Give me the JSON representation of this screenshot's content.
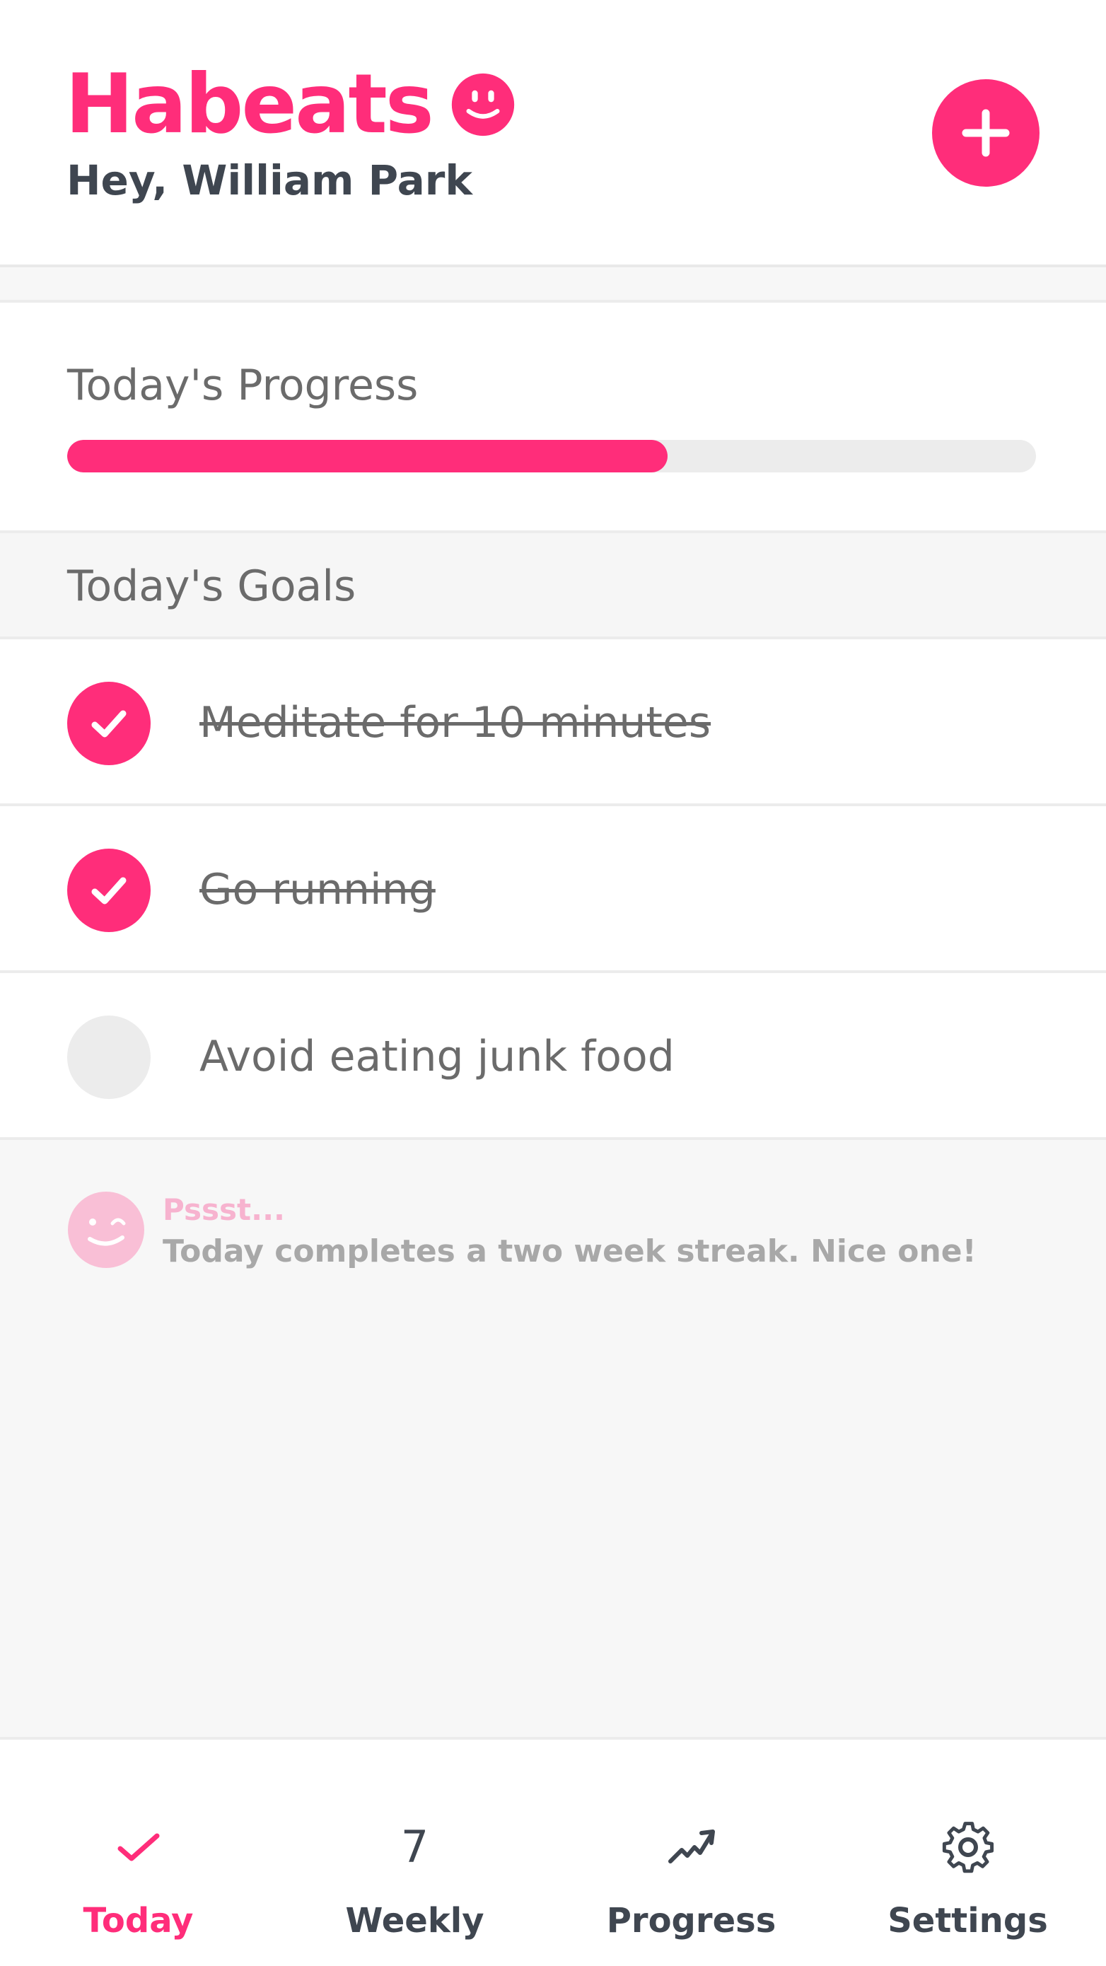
{
  "header": {
    "app_name": "Habeats",
    "greeting": "Hey, William Park",
    "add_button_icon": "plus-icon",
    "logo_icon": "smiley-icon"
  },
  "progress": {
    "title": "Today's Progress",
    "value_fraction": 0.62
  },
  "goals": {
    "title": "Today's Goals",
    "items": [
      {
        "label": "Meditate for 10 minutes",
        "done": true
      },
      {
        "label": "Go running",
        "done": true
      },
      {
        "label": "Avoid eating junk food",
        "done": false
      }
    ]
  },
  "tip": {
    "heading": "Pssst...",
    "message": "Today completes a two week streak. Nice one!",
    "icon": "winking-face-icon"
  },
  "nav": {
    "items": [
      {
        "label": "Today",
        "icon": "check-icon",
        "active": true
      },
      {
        "label": "Weekly",
        "icon": "seven-icon",
        "glyph": "7",
        "active": false
      },
      {
        "label": "Progress",
        "icon": "trend-up-icon",
        "active": false
      },
      {
        "label": "Settings",
        "icon": "gear-icon",
        "active": false
      }
    ]
  },
  "colors": {
    "accent": "#ff2d7a",
    "text_dark": "#3f4650",
    "text_muted": "#6b6b6b",
    "tip_head": "#f7b3cf",
    "background": "#f7f7f7"
  }
}
